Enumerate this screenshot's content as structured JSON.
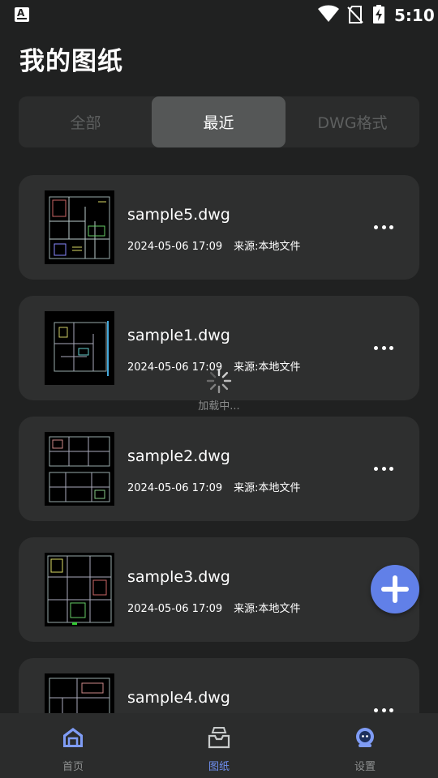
{
  "status_bar": {
    "app_icon_letter": "A",
    "time": "5:10",
    "icons": [
      "wifi-icon",
      "no-sim-icon",
      "battery-charging-icon"
    ]
  },
  "page": {
    "title": "我的图纸"
  },
  "tabs": [
    {
      "label": "全部",
      "selected": false
    },
    {
      "label": "最近",
      "selected": true
    },
    {
      "label": "DWG格式",
      "selected": false
    }
  ],
  "files": [
    {
      "name": "sample5.dwg",
      "date": "2024-05-06 17:09",
      "source": "来源:本地文件"
    },
    {
      "name": "sample1.dwg",
      "date": "2024-05-06 17:09",
      "source": "来源:本地文件"
    },
    {
      "name": "sample2.dwg",
      "date": "2024-05-06 17:09",
      "source": "来源:本地文件"
    },
    {
      "name": "sample3.dwg",
      "date": "2024-05-06 17:09",
      "source": "来源:本地文件"
    },
    {
      "name": "sample4.dwg",
      "date": "",
      "source": ""
    }
  ],
  "loading": {
    "text": "加载中..."
  },
  "fab": {
    "icon": "plus-icon",
    "color": "#6180e8"
  },
  "bottom_nav": [
    {
      "label": "首页",
      "icon": "home-icon",
      "active": false
    },
    {
      "label": "图纸",
      "icon": "drawer-tray-icon",
      "active": true
    },
    {
      "label": "设置",
      "icon": "robot-avatar-icon",
      "active": false
    }
  ],
  "colors": {
    "background": "#202121",
    "card": "#2e2f2f",
    "tab_selected": "#555757",
    "accent": "#6f8ff0"
  }
}
